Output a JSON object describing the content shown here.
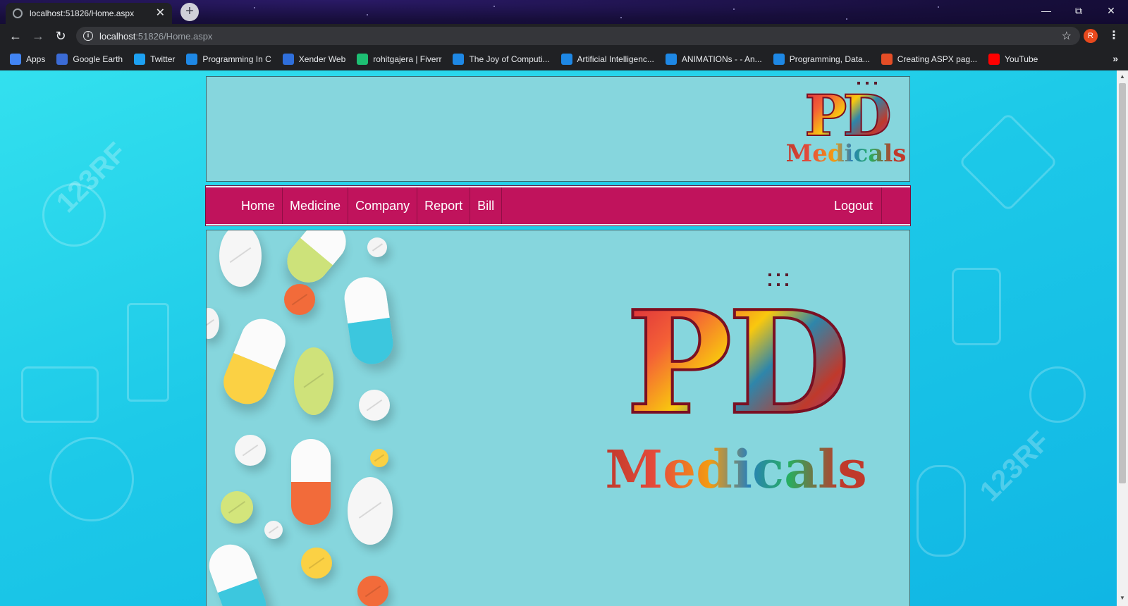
{
  "browser": {
    "tab_title": "localhost:51826/Home.aspx",
    "tab_close": "✕",
    "new_tab": "+",
    "url_host": "localhost",
    "url_path": ":51826/Home.aspx",
    "profile_initial": "R",
    "bookmarks": [
      {
        "label": "Apps",
        "icon": "apps-grid-icon",
        "color": "#4285f4"
      },
      {
        "label": "Google Earth",
        "icon": "google-earth-icon",
        "color": "#3b6bd6"
      },
      {
        "label": "Twitter",
        "icon": "twitter-icon",
        "color": "#1da1f2"
      },
      {
        "label": "Programming In C",
        "icon": "s-logo-icon",
        "color": "#1e88e5"
      },
      {
        "label": "Xender Web",
        "icon": "xender-icon",
        "color": "#2f6fdc"
      },
      {
        "label": "rohitgajera | Fiverr",
        "icon": "fiverr-icon",
        "color": "#1dbf73"
      },
      {
        "label": "The Joy of Computi...",
        "icon": "s-logo-icon",
        "color": "#1e88e5"
      },
      {
        "label": "Artificial Intelligenc...",
        "icon": "s-logo-icon",
        "color": "#1e88e5"
      },
      {
        "label": "ANIMATIONs - - An...",
        "icon": "s-logo-icon",
        "color": "#1e88e5"
      },
      {
        "label": "Programming, Data...",
        "icon": "s-logo-icon",
        "color": "#1e88e5"
      },
      {
        "label": "Creating ASPX pag...",
        "icon": "aspx-icon",
        "color": "#e44d26"
      },
      {
        "label": "YouTube",
        "icon": "youtube-icon",
        "color": "#ff0000"
      }
    ],
    "bookmarks_more": "»"
  },
  "site": {
    "logo_mono": "PD",
    "logo_word": "Medicals",
    "nav": [
      {
        "label": "Home"
      },
      {
        "label": "Medicine"
      },
      {
        "label": "Company"
      },
      {
        "label": "Report"
      },
      {
        "label": "Bill"
      }
    ],
    "logout_label": "Logout"
  },
  "colors": {
    "nav_bg": "#c0135c",
    "panel_bg": "#86d6dd",
    "page_bg": "#1dc9e8"
  }
}
